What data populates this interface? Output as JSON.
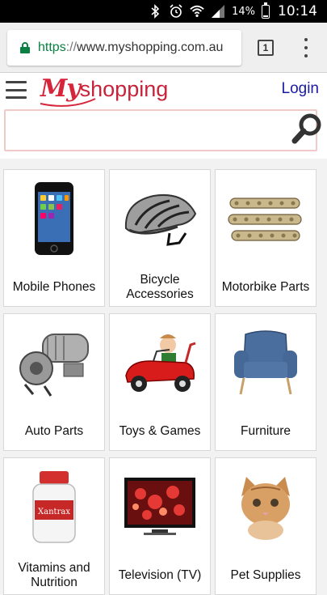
{
  "status_bar": {
    "battery_pct": "14%",
    "time": "10:14",
    "battery_level": 0.14
  },
  "browser": {
    "url_scheme": "https",
    "url_sep": "://",
    "url_host": "www.myshopping.com.au",
    "tab_count": "1"
  },
  "header": {
    "logo_my": "My",
    "logo_shopping": "shopping",
    "login_label": "Login"
  },
  "search": {
    "value": "",
    "placeholder": ""
  },
  "categories": [
    {
      "label": "Mobile Phones",
      "icon": "mobile-phone-icon"
    },
    {
      "label": "Bicycle Accessories",
      "icon": "bicycle-helmet-icon"
    },
    {
      "label": "Motorbike Parts",
      "icon": "motorbike-chain-icon"
    },
    {
      "label": "Auto Parts",
      "icon": "starter-motor-icon"
    },
    {
      "label": "Toys & Games",
      "icon": "toy-car-icon"
    },
    {
      "label": "Furniture",
      "icon": "armchair-icon"
    },
    {
      "label": "Vitamins and Nutrition",
      "icon": "vitamin-bottle-icon"
    },
    {
      "label": "Television (TV)",
      "icon": "television-icon"
    },
    {
      "label": "Pet Supplies",
      "icon": "kitten-icon"
    }
  ],
  "colors": {
    "brand_red": "#d6243a",
    "login_blue": "#1a1aa6",
    "secure_green": "#0b8043"
  }
}
